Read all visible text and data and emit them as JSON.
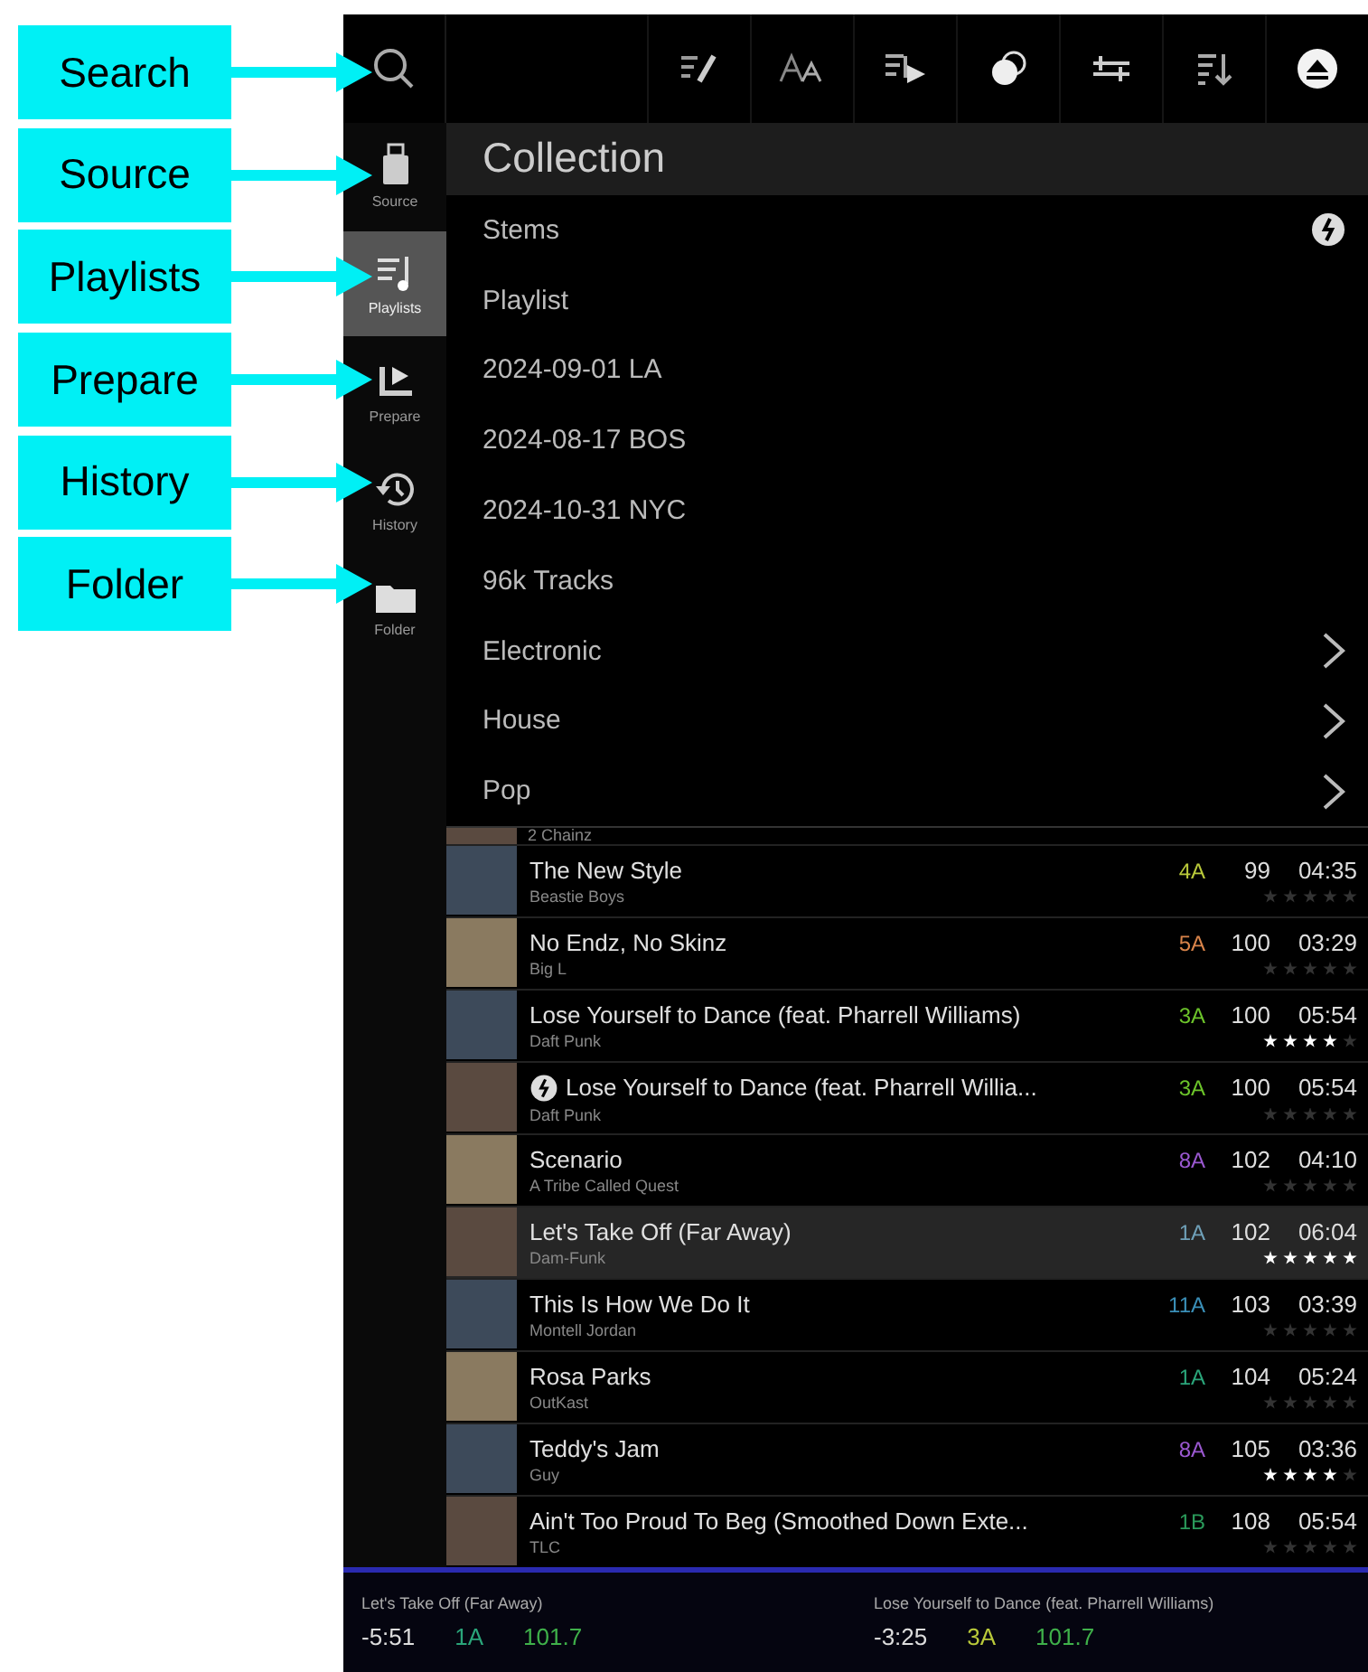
{
  "annotations": [
    {
      "label": "Search"
    },
    {
      "label": "Source"
    },
    {
      "label": "Playlists"
    },
    {
      "label": "Prepare"
    },
    {
      "label": "History"
    },
    {
      "label": "Folder"
    }
  ],
  "sidebar": {
    "items": [
      {
        "label": "Source",
        "kind": "source",
        "selected": false
      },
      {
        "label": "Playlists",
        "kind": "playlists",
        "selected": true
      },
      {
        "label": "Prepare",
        "kind": "prepare",
        "selected": false
      },
      {
        "label": "History",
        "kind": "history",
        "selected": false
      },
      {
        "label": "Folder",
        "kind": "folder",
        "selected": false
      }
    ]
  },
  "toolbar": {
    "tools": [
      {
        "kind": "edit"
      },
      {
        "kind": "font"
      },
      {
        "kind": "playlist-add"
      },
      {
        "kind": "toggle"
      },
      {
        "kind": "sliders"
      },
      {
        "kind": "sort"
      },
      {
        "kind": "eject"
      }
    ]
  },
  "header": {
    "title": "Collection"
  },
  "menu": [
    {
      "label": "Stems",
      "kind": "stems"
    },
    {
      "label": "Playlist",
      "kind": "plain"
    },
    {
      "label": "2024-09-01 LA",
      "kind": "plain"
    },
    {
      "label": "2024-08-17 BOS",
      "kind": "plain"
    },
    {
      "label": "2024-10-31 NYC",
      "kind": "plain"
    },
    {
      "label": "96k Tracks",
      "kind": "plain"
    },
    {
      "label": "Electronic",
      "kind": "folder"
    },
    {
      "label": "House",
      "kind": "folder"
    },
    {
      "label": "Pop",
      "kind": "folder"
    }
  ],
  "partial_row": {
    "artist": "2 Chainz"
  },
  "tracks": [
    {
      "title": "The New Style",
      "artist": "Beastie Boys",
      "key": "4A",
      "color": "#b9c93a",
      "bpm": "99",
      "time": "04:35",
      "stars": 0,
      "stems": false,
      "selected": false
    },
    {
      "title": "No Endz, No Skinz",
      "artist": "Big L",
      "key": "5A",
      "color": "#d9844a",
      "bpm": "100",
      "time": "03:29",
      "stars": 0,
      "stems": false,
      "selected": false
    },
    {
      "title": "Lose Yourself to Dance (feat. Pharrell Williams)",
      "artist": "Daft Punk",
      "key": "3A",
      "color": "#6cc42a",
      "bpm": "100",
      "time": "05:54",
      "stars": 4,
      "stems": false,
      "selected": false
    },
    {
      "title": "Lose Yourself to Dance (feat. Pharrell Willia...",
      "artist": "Daft Punk",
      "key": "3A",
      "color": "#6cc42a",
      "bpm": "100",
      "time": "05:54",
      "stars": 0,
      "stems": true,
      "selected": false
    },
    {
      "title": "Scenario",
      "artist": "A Tribe Called Quest",
      "key": "8A",
      "color": "#9a58d0",
      "bpm": "102",
      "time": "04:10",
      "stars": 0,
      "stems": false,
      "selected": false
    },
    {
      "title": "Let's Take Off (Far Away)",
      "artist": "Dam-Funk",
      "key": "1A",
      "color": "#6fa0b8",
      "bpm": "102",
      "time": "06:04",
      "stars": 5,
      "stems": false,
      "selected": true
    },
    {
      "title": "This Is How We Do It",
      "artist": "Montell Jordan",
      "key": "11A",
      "color": "#3a8fb8",
      "bpm": "103",
      "time": "03:39",
      "stars": 0,
      "stems": false,
      "selected": false
    },
    {
      "title": "Rosa Parks",
      "artist": "OutKast",
      "key": "1A",
      "color": "#2aa57a",
      "bpm": "104",
      "time": "05:24",
      "stars": 0,
      "stems": false,
      "selected": false
    },
    {
      "title": "Teddy's Jam",
      "artist": "Guy",
      "key": "8A",
      "color": "#9a58d0",
      "bpm": "105",
      "time": "03:36",
      "stars": 4,
      "stems": false,
      "selected": false
    },
    {
      "title": "Ain't Too Proud To Beg (Smoothed Down Exte...",
      "artist": "TLC",
      "key": "1B",
      "color": "#2a9a5a",
      "bpm": "108",
      "time": "05:54",
      "stars": 0,
      "stems": false,
      "selected": false
    }
  ],
  "decks": [
    {
      "title": "Let's Take Off (Far Away)",
      "remaining": "-5:51",
      "key": "1A",
      "color": "#2aa57a",
      "bpm": "101.7"
    },
    {
      "title": "Lose Yourself to Dance (feat. Pharrell Williams)",
      "remaining": "-3:25",
      "key": "3A",
      "color": "#b9c93a",
      "bpm": "101.7"
    }
  ]
}
